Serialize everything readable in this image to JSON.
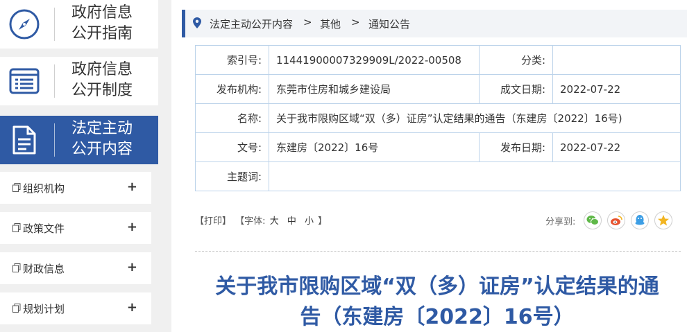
{
  "sidebar": {
    "big_items": [
      {
        "line1": "政府信息",
        "line2": "公开指南",
        "icon": "compass-icon",
        "active": false
      },
      {
        "line1": "政府信息",
        "line2": "公开制度",
        "icon": "list-document-icon",
        "active": false
      },
      {
        "line1": "法定主动",
        "line2": "公开内容",
        "icon": "document-icon",
        "active": true
      }
    ],
    "sub_items": [
      {
        "label": "组织机构",
        "plus": "+"
      },
      {
        "label": "政策文件",
        "plus": "+"
      },
      {
        "label": "财政信息",
        "plus": "+"
      },
      {
        "label": "规划计划",
        "plus": "+"
      }
    ]
  },
  "breadcrumb": {
    "items": [
      "法定主动公开内容",
      "其他",
      "通知公告"
    ],
    "separator": ">"
  },
  "meta": {
    "index_label": "索引号:",
    "index_value": "11441900007329909L/2022-00508",
    "category_label": "分类:",
    "category_value": "",
    "publisher_label": "发布机构:",
    "publisher_value": "东莞市住房和城乡建设局",
    "created_label": "成文日期:",
    "created_value": "2022-07-22",
    "name_label": "名称:",
    "name_value": "关于我市限购区域“双（多）证房”认定结果的通告（东建房〔2022〕16号)",
    "docno_label": "文号:",
    "docno_value": "东建房〔2022〕16号",
    "pubdate_label": "发布日期:",
    "pubdate_value": "2022-07-22",
    "subject_label": "主题词:",
    "subject_value": ""
  },
  "toolbar": {
    "print": "【打印】",
    "font_prefix": "【字体:",
    "font_large": "大",
    "font_medium": "中",
    "font_small": "小",
    "font_suffix": "】"
  },
  "share": {
    "label": "分享到:",
    "icons": [
      "wechat-icon",
      "weibo-icon",
      "qq-icon",
      "qzone-icon"
    ]
  },
  "article": {
    "title_line1": "关于我市限购区域“双（多）证房”认定结果的通",
    "title_line2": "告（东建房〔2022〕16号）"
  },
  "colors": {
    "primary": "#2f5aa4",
    "table_border": "#bcd3ea",
    "wechat": "#5fb848",
    "weibo": "#e6532f",
    "qq": "#3c9ee5",
    "qzone": "#f2b522"
  }
}
